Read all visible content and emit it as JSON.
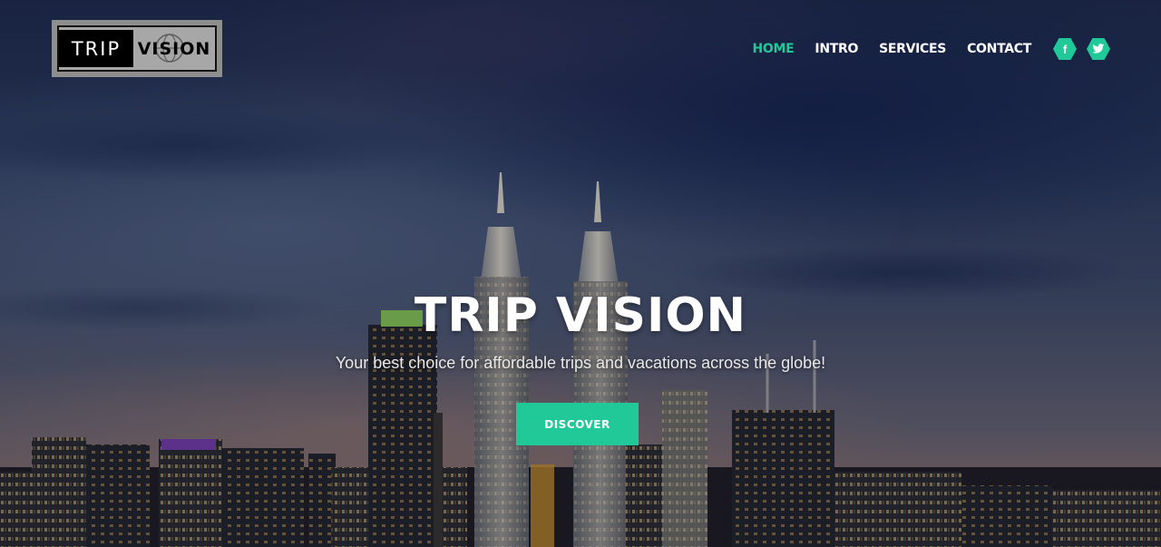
{
  "brand": {
    "logo_word_1": "TRIP",
    "logo_word_2": "VISION"
  },
  "nav": {
    "items": [
      {
        "label": "HOME",
        "active": true
      },
      {
        "label": "INTRO",
        "active": false
      },
      {
        "label": "SERVICES",
        "active": false
      },
      {
        "label": "CONTACT",
        "active": false
      }
    ]
  },
  "social": {
    "facebook_glyph": "f",
    "twitter_icon": "twitter-icon"
  },
  "hero": {
    "title": "TRIP VISION",
    "subtitle": "Your best choice for affordable trips and vacations across the globe!",
    "cta_label": "DISCOVER"
  },
  "colors": {
    "accent": "#20c997",
    "text": "#ffffff"
  }
}
